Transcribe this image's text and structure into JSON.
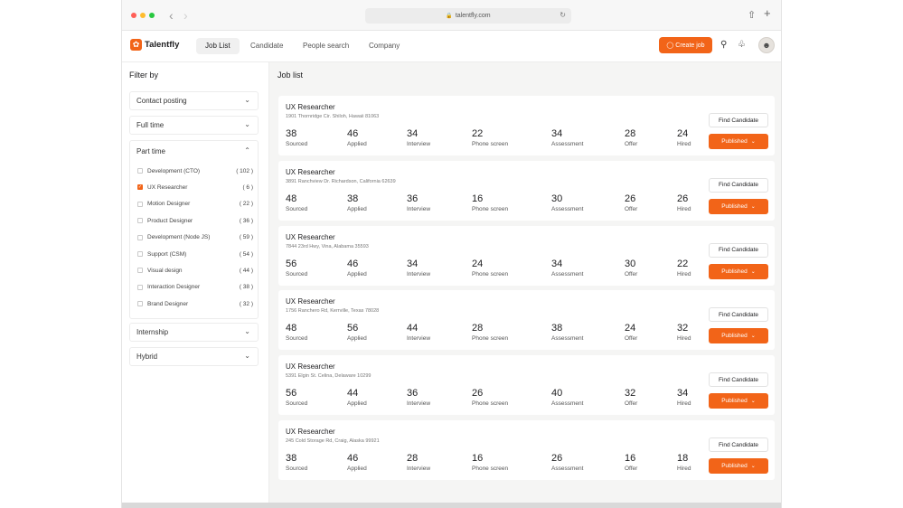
{
  "browser": {
    "url": "talentfly.com",
    "icons": {
      "lock": "lock-icon",
      "reload": "reload-icon",
      "share": "share-icon",
      "new_tab": "plus-icon"
    }
  },
  "header": {
    "brand": "Talentfly",
    "nav": [
      {
        "label": "Job List",
        "active": true
      },
      {
        "label": "Candidate",
        "active": false
      },
      {
        "label": "People search",
        "active": false
      },
      {
        "label": "Company",
        "active": false
      }
    ],
    "create_label": "Create job",
    "accent": "#f26418"
  },
  "sidebar": {
    "title": "Filter by",
    "contact_posting": "Contact posting",
    "full_time": "Full time",
    "part_time": "Part time",
    "internship": "Internship",
    "hybrid": "Hybrid",
    "options": [
      {
        "label": "Development (CTO)",
        "count": "( 102 )",
        "checked": false
      },
      {
        "label": "UX Researcher",
        "count": "( 6 )",
        "checked": true
      },
      {
        "label": "Motion Designer",
        "count": "( 22 )",
        "checked": false
      },
      {
        "label": "Product Designer",
        "count": "( 36 )",
        "checked": false
      },
      {
        "label": "Development (Node JS)",
        "count": "( 59 )",
        "checked": false
      },
      {
        "label": "Support (CSM)",
        "count": "( 54 )",
        "checked": false
      },
      {
        "label": "Visual design",
        "count": "( 44 )",
        "checked": false
      },
      {
        "label": "Interaction Designer",
        "count": "( 38 )",
        "checked": false
      },
      {
        "label": "Brand Designer",
        "count": "( 32 )",
        "checked": false
      }
    ]
  },
  "main": {
    "title": "Job list",
    "stat_labels": [
      "Sourced",
      "Applied",
      "Interview",
      "Phone screen",
      "Assessment",
      "Offer",
      "Hired"
    ],
    "find_label": "Find Candidate",
    "published_label": "Published",
    "jobs": [
      {
        "title": "UX Researcher",
        "address": "1901 Thornridge Cir. Shiloh, Hawaii 81063",
        "stats": [
          "38",
          "46",
          "34",
          "22",
          "34",
          "28",
          "24"
        ]
      },
      {
        "title": "UX Researcher",
        "address": "3891 Ranchview Dr. Richardson, California 62639",
        "stats": [
          "48",
          "38",
          "36",
          "16",
          "30",
          "26",
          "26"
        ]
      },
      {
        "title": "UX Researcher",
        "address": "7844 23rd Hwy, Vina, Alabama 35593",
        "stats": [
          "56",
          "46",
          "34",
          "24",
          "34",
          "30",
          "22"
        ]
      },
      {
        "title": "UX Researcher",
        "address": "1756 Ranchero Rd, Kerrville, Texas 78028",
        "stats": [
          "48",
          "56",
          "44",
          "28",
          "38",
          "24",
          "32"
        ]
      },
      {
        "title": "UX Researcher",
        "address": "5391 Elgin St. Celina, Delaware 10299",
        "stats": [
          "56",
          "44",
          "36",
          "26",
          "40",
          "32",
          "34"
        ]
      },
      {
        "title": "UX Researcher",
        "address": "245 Cold Storage Rd, Craig, Alaska 99921",
        "stats": [
          "38",
          "46",
          "28",
          "16",
          "26",
          "16",
          "18"
        ]
      }
    ]
  }
}
